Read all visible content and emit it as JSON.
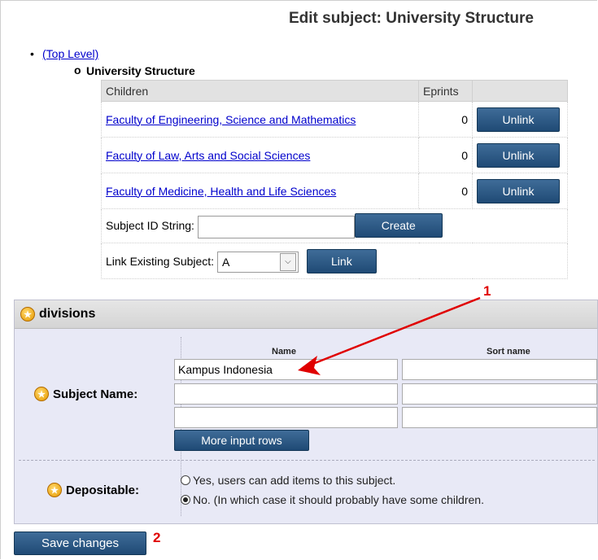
{
  "page": {
    "title": "Edit subject: University Structure"
  },
  "tree": {
    "top_level": "(Top Level)",
    "current": "University Structure"
  },
  "children_table": {
    "headers": [
      "Children",
      "Eprints",
      ""
    ],
    "rows": [
      {
        "name": "Faculty of Engineering, Science and Mathematics",
        "eprints": "0",
        "action": "Unlink"
      },
      {
        "name": "Faculty of Law, Arts and Social Sciences",
        "eprints": "0",
        "action": "Unlink"
      },
      {
        "name": "Faculty of Medicine, Health and Life Sciences",
        "eprints": "0",
        "action": "Unlink"
      }
    ],
    "create_label": "Subject ID String:",
    "create_value": "",
    "create_button": "Create",
    "link_label": "Link Existing Subject:",
    "link_select_value": "A",
    "link_button": "Link"
  },
  "panel": {
    "title": "divisions",
    "subject_name_label": "Subject Name:",
    "col_name": "Name",
    "col_sort": "Sort name",
    "rows": [
      {
        "name": "Kampus Indonesia",
        "sort": ""
      },
      {
        "name": "",
        "sort": ""
      },
      {
        "name": "",
        "sort": ""
      }
    ],
    "more_rows_button": "More input rows",
    "depositable_label": "Depositable:",
    "option_yes": "Yes, users can add items to this subject.",
    "option_no": "No. (In which case it should probably have some children.",
    "selected": "no"
  },
  "save_button": "Save changes",
  "annotations": {
    "one": "1",
    "two": "2",
    "color": "#e00000"
  }
}
